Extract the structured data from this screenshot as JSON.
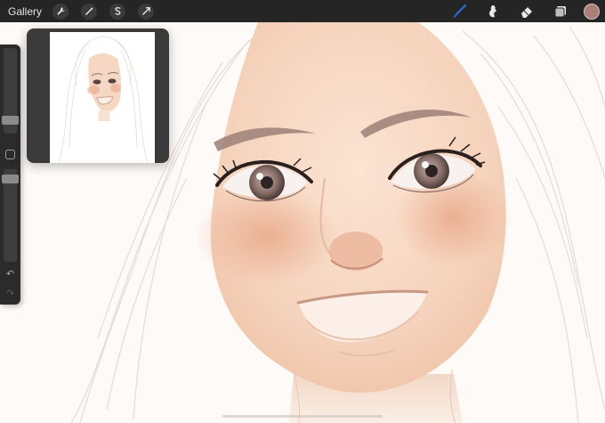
{
  "toolbar": {
    "gallery_label": "Gallery",
    "left_tools": [
      "wrench-icon",
      "magic-wand-icon",
      "selection-icon",
      "transform-arrow-icon"
    ],
    "right_tools": [
      "brush-icon",
      "smudge-icon",
      "eraser-icon",
      "layers-icon"
    ],
    "active_color": "#a97f78",
    "active_tool_color": "#2f6cd9"
  },
  "sidebar": {
    "controls": [
      "brush-size-slider",
      "modify-button",
      "opacity-slider",
      "undo-icon",
      "redo-icon"
    ]
  },
  "reference_window": {
    "content": "reference-thumbnail"
  },
  "canvas": {
    "subject": "portrait-illustration"
  }
}
